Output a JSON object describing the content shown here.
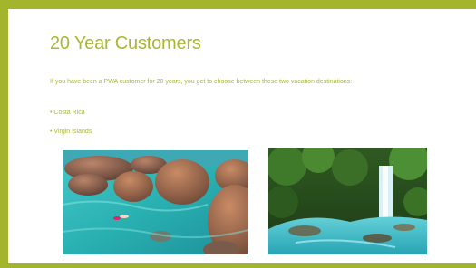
{
  "slide": {
    "title": "20 Year Customers",
    "body": "If you have been a PWA customer for 20 years, you get to choose between these two vacation destinations:",
    "bullets": [
      {
        "label": "• Costa Rica"
      },
      {
        "label": "• Virgin Islands"
      }
    ],
    "images": [
      {
        "name": "boulders-beach-photo"
      },
      {
        "name": "waterfall-river-photo"
      }
    ]
  },
  "colors": {
    "accent": "#a3b52c",
    "title_text": "#a9b733",
    "background": "#ffffff"
  }
}
